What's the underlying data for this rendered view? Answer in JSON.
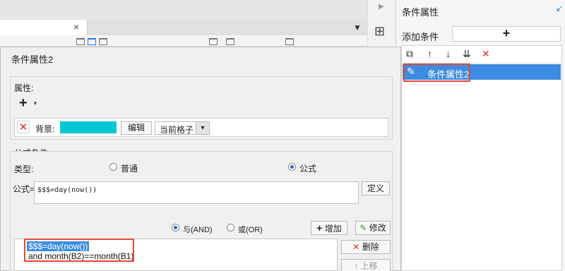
{
  "right_panel": {
    "title": "条件属性",
    "add_condition_label": "添加条件",
    "add_button": "+",
    "toolbar_icons": [
      "copy-icon",
      "arrow-up-icon",
      "arrow-down-icon",
      "sort-down-icon",
      "delete-icon"
    ],
    "items": [
      {
        "label": "条件属性2",
        "selected": true
      }
    ]
  },
  "designer": {
    "tab_close": "×"
  },
  "dialog": {
    "title": "条件属性2",
    "attribute_group_label": "属性:",
    "add_attr_button": "+",
    "background_label": "背景:",
    "background_color": "#00c8d2",
    "edit_button": "编辑",
    "scope_select": "当前格子",
    "formula_group_label": "公式条件",
    "type_label": "类型:",
    "type_normal": "普通",
    "type_formula": "公式",
    "formula_label": "公式=",
    "formula_value": "$$$=day(now())",
    "define_button": "定义",
    "and_label": "与(AND)",
    "or_label": "或(OR)",
    "add_button": "增加",
    "modify_button": "修改",
    "delete_button": "删除",
    "moveup_button": "上移",
    "conditions": [
      "$$$=day(now())",
      "and month(B2)==month(B1)"
    ]
  },
  "colors": {
    "selection": "#3e8be0",
    "highlight_border": "#e04b3a",
    "delete_red": "#d9302b"
  }
}
